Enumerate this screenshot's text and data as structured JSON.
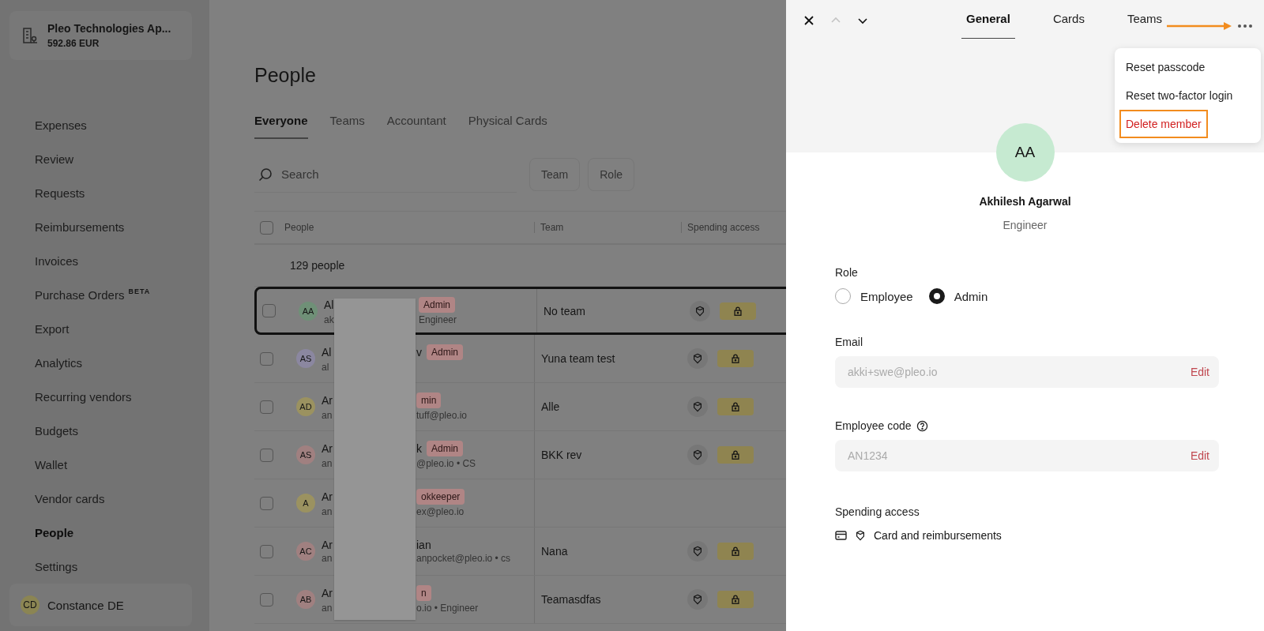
{
  "sidebar": {
    "company": {
      "name": "Pleo Technologies Ap...",
      "balance": "592.86 EUR"
    },
    "items": [
      {
        "label": "Expenses",
        "selected": false
      },
      {
        "label": "Review",
        "selected": false
      },
      {
        "label": "Requests",
        "selected": false
      },
      {
        "label": "Reimbursements",
        "selected": false
      },
      {
        "label": "Invoices",
        "selected": false
      },
      {
        "label": "Purchase Orders",
        "badge": "BETA",
        "selected": false
      },
      {
        "label": "Export",
        "selected": false
      },
      {
        "label": "Analytics",
        "selected": false
      },
      {
        "label": "Recurring vendors",
        "selected": false
      },
      {
        "label": "Budgets",
        "selected": false
      },
      {
        "label": "Wallet",
        "selected": false
      },
      {
        "label": "Vendor cards",
        "selected": false
      },
      {
        "label": "People",
        "selected": true
      },
      {
        "label": "Settings",
        "selected": false
      }
    ],
    "user": {
      "initials": "CD",
      "name": "Constance DE"
    }
  },
  "main": {
    "title": "People",
    "tabs": [
      {
        "label": "Everyone",
        "selected": true
      },
      {
        "label": "Teams",
        "selected": false
      },
      {
        "label": "Accountant",
        "selected": false
      },
      {
        "label": "Physical Cards",
        "selected": false
      }
    ],
    "search": {
      "placeholder": "Search"
    },
    "filters": [
      "Team",
      "Role"
    ],
    "table": {
      "all_checked": false,
      "columns": [
        "People",
        "Team",
        "Spending access"
      ],
      "group": "129 people",
      "rows": [
        {
          "initials": "AA",
          "color": "#6f9077",
          "name_start": "Al",
          "name_end": "",
          "badge": "Admin",
          "email_start": "ak",
          "email_end": "Engineer",
          "team": "No team",
          "spending": true,
          "checked": false,
          "selected": true
        },
        {
          "initials": "AS",
          "color": "#8b87a0",
          "name_start": "Al",
          "name_end": "v",
          "badge": "Admin",
          "email_start": "al",
          "email_end": "",
          "team": "Yuna team test",
          "spending": true,
          "checked": false,
          "selected": false
        },
        {
          "initials": "AD",
          "color": "#9b9260",
          "name_start": "Ar",
          "name_end": "",
          "badge": "min",
          "email_start": "an",
          "email_end": "tuff@pleo.io",
          "team": "Alle",
          "spending": true,
          "checked": false,
          "selected": false
        },
        {
          "initials": "AS",
          "color": "#a08080",
          "name_start": "Ar",
          "name_end": "k",
          "badge": "Admin",
          "email_start": "an",
          "email_end": "@pleo.io • CS",
          "team": "BKK rev",
          "spending": true,
          "checked": false,
          "selected": false
        },
        {
          "initials": "A",
          "color": "#9b9260",
          "name_start": "Ar",
          "name_end": "",
          "badge": "okkeeper",
          "email_start": "an",
          "email_end": "ex@pleo.io",
          "spending": false,
          "checked": false,
          "selected": false
        },
        {
          "initials": "AC",
          "color": "#a08080",
          "name_start": "Ar",
          "name_end": "ian",
          "email_start": "an",
          "email_end": "anpocket@pleo.io • cs",
          "team": "Nana",
          "spending": true,
          "checked": false,
          "selected": false
        },
        {
          "initials": "AB",
          "color": "#a08080",
          "name_start": "Ar",
          "name_end": "",
          "badge": "n",
          "email_start": "an",
          "email_end": "o.io • Engineer",
          "team": "Teamasdfas",
          "spending": true,
          "checked": false,
          "selected": false
        }
      ]
    }
  },
  "panel": {
    "previous_disabled": true,
    "tabs": [
      {
        "label": "General",
        "selected": true
      },
      {
        "label": "Cards",
        "selected": false
      },
      {
        "label": "Teams",
        "selected": false
      }
    ],
    "menu": [
      {
        "label": "Reset passcode",
        "kind": "normal",
        "highlighted": false
      },
      {
        "label": "Reset two-factor login",
        "kind": "normal",
        "highlighted": false
      },
      {
        "label": "Delete member",
        "kind": "danger",
        "highlighted": true
      }
    ],
    "profile": {
      "initials": "AA",
      "name": "Akhilesh Agarwal",
      "title": "Engineer"
    },
    "role": {
      "label": "Role",
      "options": [
        {
          "label": "Employee",
          "selected": false
        },
        {
          "label": "Admin",
          "selected": true
        }
      ]
    },
    "fields": [
      {
        "label": "Email",
        "value": "akki+swe@pleo.io",
        "action": "Edit",
        "help": false
      },
      {
        "label": "Employee code",
        "value": "AN1234",
        "action": "Edit",
        "help": true
      }
    ],
    "spending": {
      "label": "Spending access",
      "value": "Card and reimbursements"
    }
  }
}
